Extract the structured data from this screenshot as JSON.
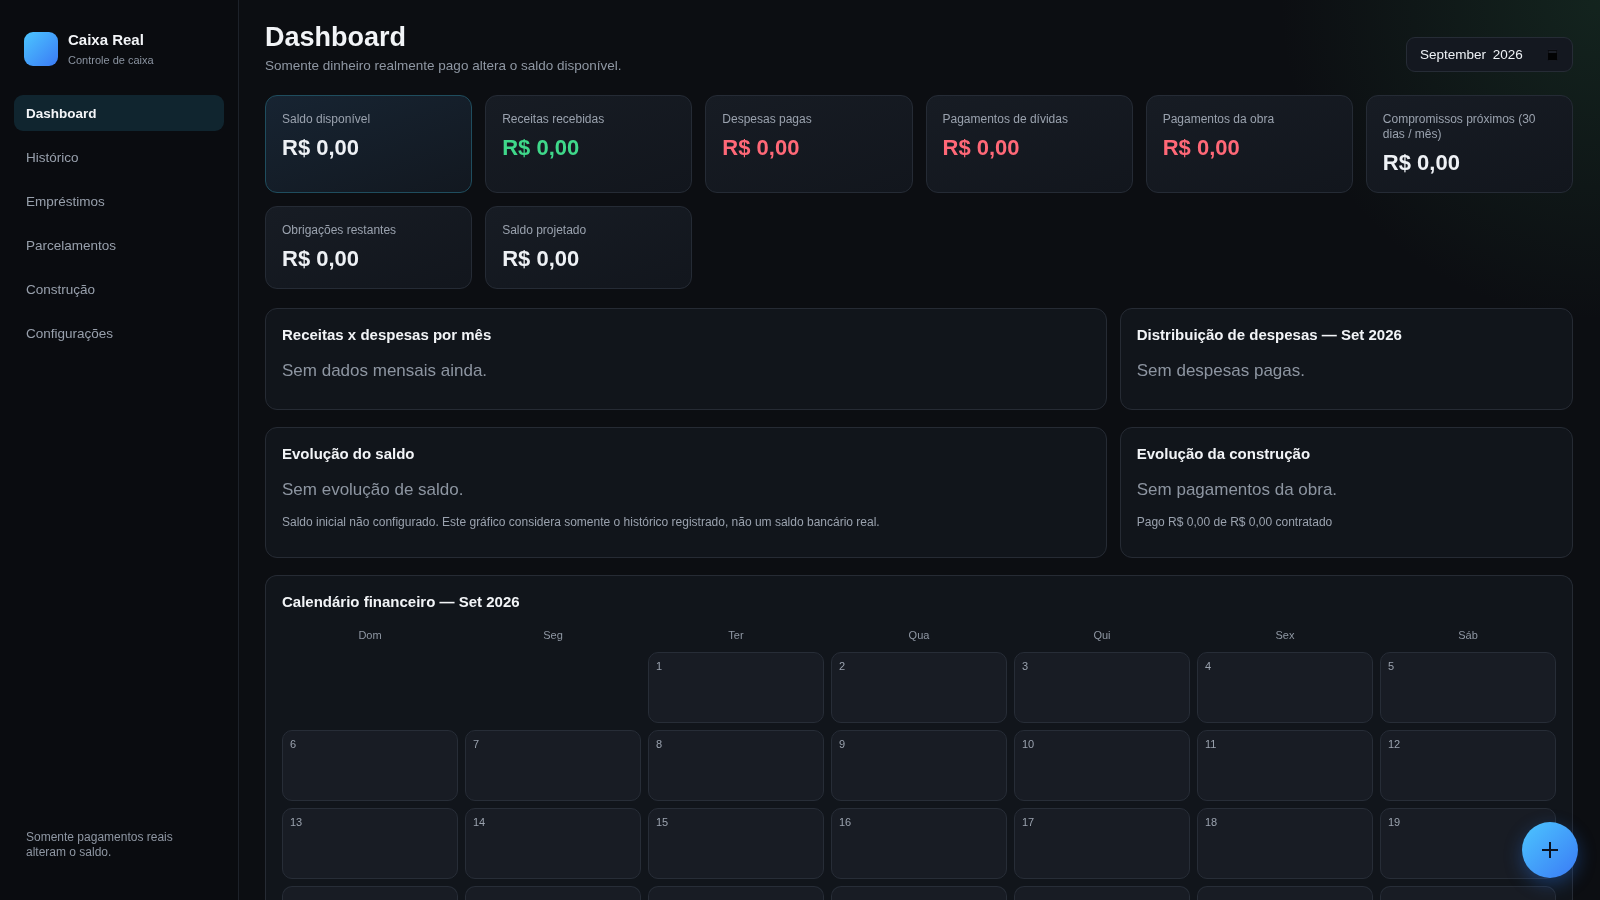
{
  "brand": {
    "name": "Caixa Real",
    "subtitle": "Controle de caixa"
  },
  "sidebar": {
    "items": [
      {
        "label": "Dashboard",
        "selected": true
      },
      {
        "label": "Histórico",
        "selected": false
      },
      {
        "label": "Empréstimos",
        "selected": false
      },
      {
        "label": "Parcelamentos",
        "selected": false
      },
      {
        "label": "Construção",
        "selected": false
      },
      {
        "label": "Configurações",
        "selected": false
      }
    ],
    "footer": "Somente pagamentos reais alteram o saldo."
  },
  "header": {
    "title": "Dashboard",
    "subtitle": "Somente dinheiro realmente pago altera o saldo disponível.",
    "month_picker": {
      "value": "September 2026"
    }
  },
  "stats": [
    {
      "label": "Saldo disponível",
      "value": "R$ 0,00",
      "kind": "neutral",
      "highlighted": true
    },
    {
      "label": "Receitas recebidas",
      "value": "R$ 0,00",
      "kind": "positive",
      "highlighted": false
    },
    {
      "label": "Despesas pagas",
      "value": "R$ 0,00",
      "kind": "negative",
      "highlighted": false
    },
    {
      "label": "Pagamentos de dívidas",
      "value": "R$ 0,00",
      "kind": "negative",
      "highlighted": false
    },
    {
      "label": "Pagamentos da obra",
      "value": "R$ 0,00",
      "kind": "negative",
      "highlighted": false
    },
    {
      "label": "Compromissos próximos (30 dias / mês)",
      "value": "R$ 0,00",
      "kind": "neutral",
      "highlighted": false
    },
    {
      "label": "Obrigações restantes",
      "value": "R$ 0,00",
      "kind": "neutral",
      "highlighted": false
    },
    {
      "label": "Saldo projetado",
      "value": "R$ 0,00",
      "kind": "neutral",
      "highlighted": false
    }
  ],
  "panels": [
    {
      "title": "Receitas x despesas por mês",
      "empty_message": "Sem dados mensais ainda."
    },
    {
      "title": "Distribuição de despesas — Set 2026",
      "empty_message": "Sem despesas pagas."
    },
    {
      "title": "Evolução do saldo",
      "empty_message": "Sem evolução de saldo.",
      "note": "Saldo inicial não configurado. Este gráfico considera somente o histórico registrado, não um saldo bancário real."
    },
    {
      "title": "Evolução da construção",
      "empty_message": "Sem pagamentos da obra.",
      "note": "Pago R$ 0,00 de R$ 0,00 contratado"
    }
  ],
  "calendar": {
    "title": "Calendário financeiro — Set 2026",
    "weekdays": [
      "Dom",
      "Seg",
      "Ter",
      "Qua",
      "Qui",
      "Sex",
      "Sáb"
    ],
    "weeks": [
      {
        "days": [
          {
            "kind": "blank"
          },
          {
            "kind": "blank"
          },
          {
            "kind": "day",
            "day": "1"
          },
          {
            "kind": "day",
            "day": "2"
          },
          {
            "kind": "day",
            "day": "3"
          },
          {
            "kind": "day",
            "day": "4"
          },
          {
            "kind": "day",
            "day": "5"
          }
        ]
      },
      {
        "days": [
          {
            "kind": "day",
            "day": "6"
          },
          {
            "kind": "day",
            "day": "7"
          },
          {
            "kind": "day",
            "day": "8"
          },
          {
            "kind": "day",
            "day": "9"
          },
          {
            "kind": "day",
            "day": "10"
          },
          {
            "kind": "day",
            "day": "11"
          },
          {
            "kind": "day",
            "day": "12"
          }
        ]
      },
      {
        "days": [
          {
            "kind": "day",
            "day": "13"
          },
          {
            "kind": "day",
            "day": "14"
          },
          {
            "kind": "day",
            "day": "15"
          },
          {
            "kind": "day",
            "day": "16"
          },
          {
            "kind": "day",
            "day": "17"
          },
          {
            "kind": "day",
            "day": "18"
          },
          {
            "kind": "day",
            "day": "19"
          }
        ]
      },
      {
        "days": [
          {
            "kind": "clipped"
          },
          {
            "kind": "clipped"
          },
          {
            "kind": "clipped"
          },
          {
            "kind": "clipped"
          },
          {
            "kind": "clipped"
          },
          {
            "kind": "clipped"
          },
          {
            "kind": "clipped"
          }
        ]
      }
    ]
  }
}
